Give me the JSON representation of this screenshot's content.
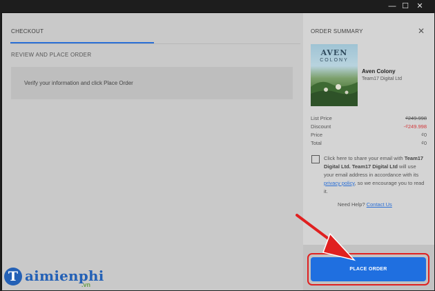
{
  "window": {
    "minimize_icon": "minimize-icon",
    "maximize_icon": "maximize-icon",
    "close_icon": "close-icon"
  },
  "checkout": {
    "tab_label": "CHECKOUT",
    "section_title": "REVIEW AND PLACE ORDER",
    "info_text": "Verify your information and click Place Order"
  },
  "summary": {
    "title": "ORDER SUMMARY",
    "close_icon": "close-icon",
    "game": {
      "cover_title": "AVEN",
      "cover_subtitle": "COLONY",
      "name": "Aven Colony",
      "publisher": "Team17 Digital Ltd"
    },
    "rows": [
      {
        "label": "List Price",
        "value": "₫249.998"
      },
      {
        "label": "Discount",
        "value": "-₫249.998"
      },
      {
        "label": "Price",
        "value": "₫0"
      },
      {
        "label": "Total",
        "value": "₫0"
      }
    ],
    "consent": {
      "part1": "Click here to share your email with ",
      "bold1": "Team17 Digital Ltd. Team17 Digital Ltd",
      "part2": " will use your email address in accordance with its ",
      "link": "privacy policy",
      "part3": ", so we encourage you to read it."
    },
    "help": {
      "label": "Need Help?",
      "link": "Contact Us"
    },
    "place_order": "PLACE ORDER"
  },
  "watermark": {
    "brand": "aimienphi",
    "initial": "T",
    "suffix": ".vn"
  },
  "colors": {
    "accent_blue": "#1f6fe0",
    "discount_red": "#d2373a",
    "highlight_red": "#e02020"
  }
}
